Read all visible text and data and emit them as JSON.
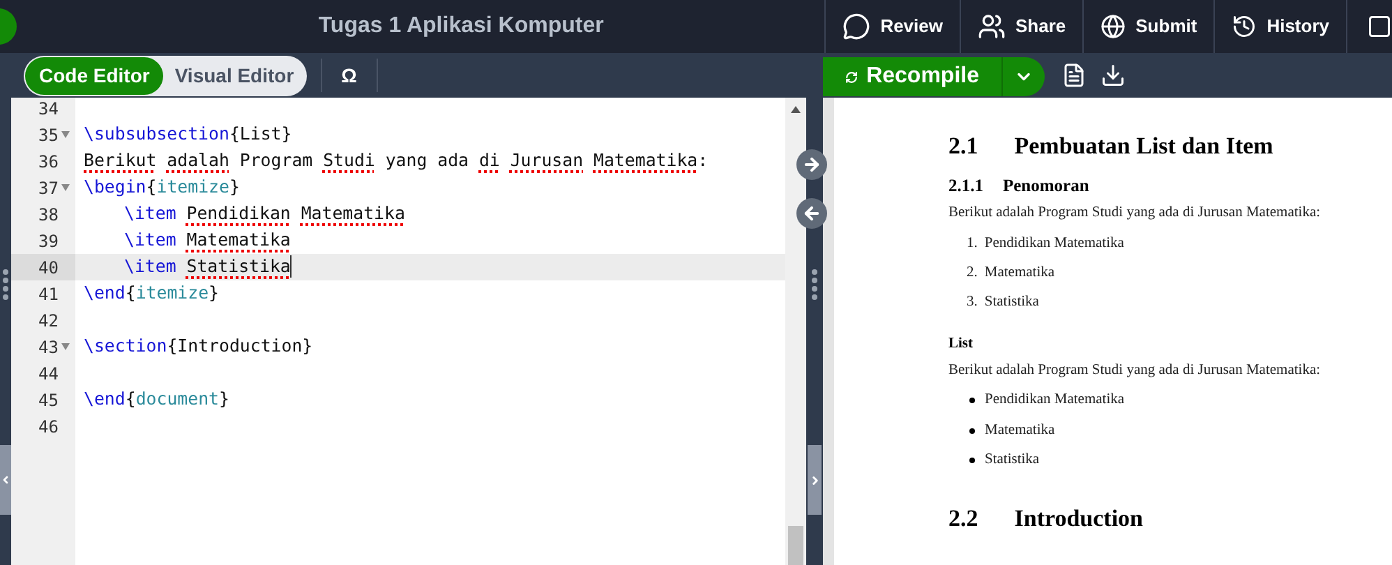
{
  "app": {
    "title": "Tugas 1 Aplikasi Komputer"
  },
  "top_menu": [
    {
      "kind": "review",
      "label": "Review"
    },
    {
      "kind": "share",
      "label": "Share"
    },
    {
      "kind": "submit",
      "label": "Submit"
    },
    {
      "kind": "history",
      "label": "History"
    }
  ],
  "editor_modes": [
    {
      "label": "Code Editor",
      "selected": true
    },
    {
      "label": "Visual Editor",
      "selected": false
    }
  ],
  "symbol_button": "Ω",
  "recompile": {
    "label": "Recompile"
  },
  "code_lines": [
    {
      "number": "34",
      "foldable": false,
      "active": false
    },
    {
      "number": "35",
      "foldable": true,
      "active": false,
      "tokens": [
        {
          "kind": "command",
          "text": "\\subsubsection"
        },
        {
          "kind": "text",
          "text": "{List}"
        }
      ]
    },
    {
      "number": "36",
      "foldable": false,
      "active": false,
      "tokens": [
        {
          "kind": "misspelled",
          "text": "Berikut"
        },
        {
          "kind": "misspelled",
          "text": "adalah",
          "space_before": true
        },
        {
          "kind": "text",
          "text": "Program",
          "space_before": true
        },
        {
          "kind": "misspelled",
          "text": "Studi",
          "space_before": true
        },
        {
          "kind": "text",
          "text": "yang ada",
          "space_before": true
        },
        {
          "kind": "misspelled",
          "text": "di",
          "space_before": true
        },
        {
          "kind": "misspelled",
          "text": "Jurusan",
          "space_before": true
        },
        {
          "kind": "misspelled",
          "text": "Matematika",
          "space_before": true
        },
        {
          "kind": "text",
          "text": ":"
        }
      ]
    },
    {
      "number": "37",
      "foldable": true,
      "active": false,
      "tokens": [
        {
          "kind": "command",
          "text": "\\begin"
        },
        {
          "kind": "text",
          "text": "{"
        },
        {
          "kind": "env",
          "text": "itemize"
        },
        {
          "kind": "text",
          "text": "}"
        }
      ]
    },
    {
      "number": "38",
      "foldable": false,
      "active": false,
      "indented": true,
      "tokens": [
        {
          "kind": "command",
          "text": "\\item"
        },
        {
          "kind": "misspelled",
          "text": "Pendidikan",
          "space_before": true
        },
        {
          "kind": "misspelled",
          "text": "Matematika",
          "space_before": true
        }
      ]
    },
    {
      "number": "39",
      "foldable": false,
      "active": false,
      "indented": true,
      "tokens": [
        {
          "kind": "command",
          "text": "\\item"
        },
        {
          "kind": "misspelled",
          "text": "Matematika",
          "space_before": true
        }
      ]
    },
    {
      "number": "40",
      "foldable": false,
      "active": true,
      "indented": true,
      "tokens": [
        {
          "kind": "command",
          "text": "\\item"
        },
        {
          "kind": "misspelled",
          "text": "Statistika",
          "space_before": true
        }
      ]
    },
    {
      "number": "41",
      "foldable": false,
      "active": false,
      "tokens": [
        {
          "kind": "command",
          "text": "\\end"
        },
        {
          "kind": "text",
          "text": "{"
        },
        {
          "kind": "env",
          "text": "itemize"
        },
        {
          "kind": "text",
          "text": "}"
        }
      ]
    },
    {
      "number": "42",
      "foldable": false,
      "active": false
    },
    {
      "number": "43",
      "foldable": true,
      "active": false,
      "tokens": [
        {
          "kind": "command",
          "text": "\\section"
        },
        {
          "kind": "text",
          "text": "{Introduction}"
        }
      ]
    },
    {
      "number": "44",
      "foldable": false,
      "active": false
    },
    {
      "number": "45",
      "foldable": false,
      "active": false,
      "tokens": [
        {
          "kind": "command",
          "text": "\\end"
        },
        {
          "kind": "text",
          "text": "{"
        },
        {
          "kind": "env",
          "text": "document"
        },
        {
          "kind": "text",
          "text": "}"
        }
      ]
    },
    {
      "number": "46",
      "foldable": false,
      "active": false
    }
  ],
  "preview": {
    "blocks": [
      {
        "kind": "section",
        "number": "2.1",
        "title": "Pembuatan List dan Item"
      },
      {
        "kind": "subsubsection",
        "number": "2.1.1",
        "title": "Penomoran"
      },
      {
        "kind": "paragraph",
        "text": "Berikut adalah Program Studi yang ada di Jurusan Matematika:"
      },
      {
        "kind": "enumerate",
        "items": [
          {
            "marker": "1.",
            "text": "Pendidikan Matematika"
          },
          {
            "marker": "2.",
            "text": "Matematika"
          },
          {
            "marker": "3.",
            "text": "Statistika"
          }
        ]
      },
      {
        "kind": "paragraph_heading",
        "text": "List"
      },
      {
        "kind": "paragraph",
        "text": "Berikut adalah Program Studi yang ada di Jurusan Matematika:"
      },
      {
        "kind": "itemize",
        "items": [
          {
            "text": "Pendidikan Matematika"
          },
          {
            "text": "Matematika"
          },
          {
            "text": "Statistika"
          }
        ]
      },
      {
        "kind": "section",
        "number": "2.2",
        "title": "Introduction"
      }
    ]
  }
}
